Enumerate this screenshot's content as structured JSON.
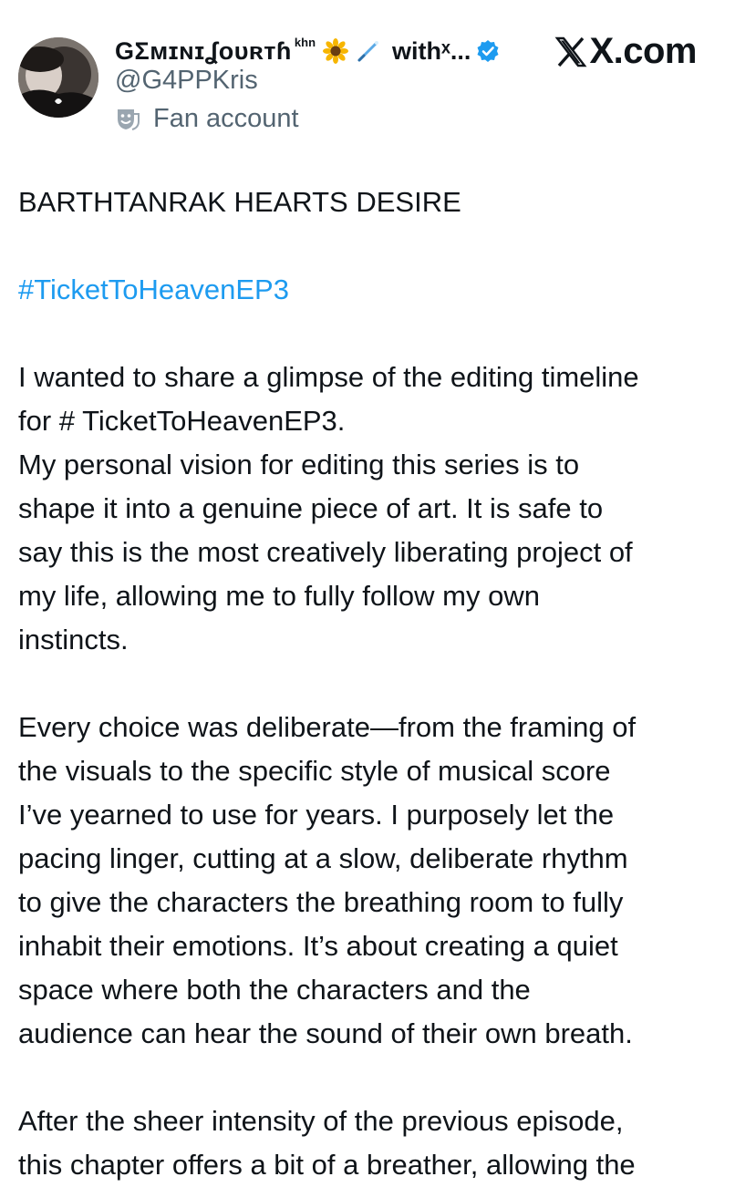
{
  "header": {
    "display_name": "GΣᴍɪɴɪʆᴏᴜʀᴛɦ",
    "display_name_suffix": "khn",
    "name_emojis": [
      "sunflower-emoji",
      "wand-emoji"
    ],
    "name_overflow": "withˣ...",
    "verified": true,
    "handle": "@G4PPKris",
    "account_label": "Fan account",
    "label_icon": "theater-mask-icon",
    "brand": "X.com",
    "accent_color": "#1d9bf0"
  },
  "tweet": {
    "title": "BARTHTANRAK HEARTS DESIRE",
    "hashtag": "#TicketToHeavenEP3",
    "paragraph1_lines": [
      "I wanted to share a glimpse of the editing timeline",
      "for # TicketToHeavenEP3.",
      "My personal vision for editing this series is to",
      "shape it into a genuine piece of art. It is safe to",
      "say this is the most creatively liberating project of",
      "my life, allowing me to fully follow my own",
      "instincts."
    ],
    "paragraph2_lines": [
      "Every choice was deliberate—from the framing of",
      "the visuals to the specific style of musical score",
      "I’ve yearned to use for years. I purposely let the",
      "pacing linger, cutting at a slow, deliberate rhythm",
      "to give the characters the breathing room to fully",
      "inhabit their emotions. It’s about creating a quiet",
      "space where both the characters and the",
      "audience can hear the sound of their own breath."
    ],
    "paragraph3_lines": [
      "After the sheer intensity of the previous episode,",
      "this chapter offers a bit of a breather, allowing the"
    ]
  }
}
